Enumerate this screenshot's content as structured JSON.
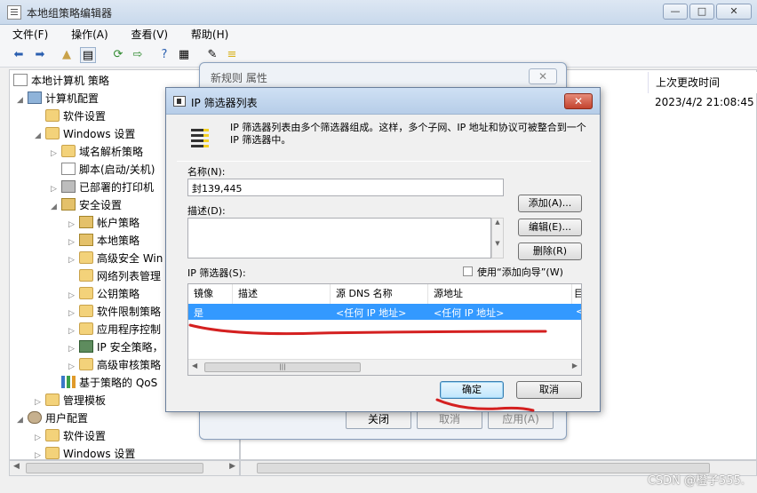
{
  "window": {
    "title": "本地组策略编辑器",
    "buttons": {
      "minimize": "—",
      "maximize": "□",
      "close": "✕"
    }
  },
  "menu": [
    "文件(F)",
    "操作(A)",
    "查看(V)",
    "帮助(H)"
  ],
  "tree": {
    "items": [
      {
        "label": "本地计算机 策略",
        "icon": "doc-icon"
      },
      {
        "label": "计算机配置",
        "icon": "computer-icon"
      },
      {
        "label": "软件设置",
        "icon": "folder-icon"
      },
      {
        "label": "Windows 设置",
        "icon": "folder-icon"
      },
      {
        "label": "域名解析策略",
        "icon": "folder-icon"
      },
      {
        "label": "脚本(启动/关机)",
        "icon": "doc-icon"
      },
      {
        "label": "已部署的打印机",
        "icon": "printer-icon"
      },
      {
        "label": "安全设置",
        "icon": "lock-icon"
      },
      {
        "label": "帐户策略",
        "icon": "lock-icon"
      },
      {
        "label": "本地策略",
        "icon": "lock-icon"
      },
      {
        "label": "高级安全 Win",
        "icon": "folder-icon"
      },
      {
        "label": "网络列表管理",
        "icon": "folder-icon"
      },
      {
        "label": "公钥策略",
        "icon": "folder-icon"
      },
      {
        "label": "软件限制策略",
        "icon": "folder-icon"
      },
      {
        "label": "应用程序控制",
        "icon": "folder-icon"
      },
      {
        "label": "IP 安全策略，",
        "icon": "network-icon"
      },
      {
        "label": "高级审核策略",
        "icon": "folder-icon"
      },
      {
        "label": "基于策略的 QoS",
        "icon": "chart-icon"
      },
      {
        "label": "管理模板",
        "icon": "folder-icon"
      },
      {
        "label": "用户配置",
        "icon": "user-icon"
      },
      {
        "label": "软件设置",
        "icon": "folder-icon"
      },
      {
        "label": "Windows 设置",
        "icon": "folder-icon"
      }
    ]
  },
  "rightpane": {
    "column_header": "上次更改时间",
    "row_date": "2023/4/2 21:08:45"
  },
  "rule_dialog": {
    "title": "新规则 属性",
    "close_label": "✕",
    "close_button": "关闭",
    "cancel_button": "取消",
    "apply_button": "应用(A)"
  },
  "ip_dialog": {
    "title": "IP 筛选器列表",
    "close_label": "✕",
    "description": "IP 筛选器列表由多个筛选器组成。这样，多个子网、IP 地址和协议可被整合到一个 IP 筛选器中。",
    "name_label": "名称(N):",
    "name_value": "封139,445",
    "desc_label": "描述(D):",
    "add_button": "添加(A)...",
    "edit_button": "编辑(E)...",
    "remove_button": "删除(R)",
    "filters_label": "IP 筛选器(S):",
    "wizard_label": "使用“添加向导”(W)",
    "wizard_checked": false,
    "columns": [
      "镜像",
      "描述",
      "源 DNS 名称",
      "源地址",
      "目"
    ],
    "rows": [
      {
        "mirror": "是",
        "description": "",
        "src_dns": "<任何 IP 地址>",
        "src_addr": "<任何 IP 地址>"
      }
    ],
    "ok_button": "确定",
    "cancel_button": "取消"
  },
  "watermark": "CSDN @橙子555.",
  "annotation_color": "#d42020"
}
